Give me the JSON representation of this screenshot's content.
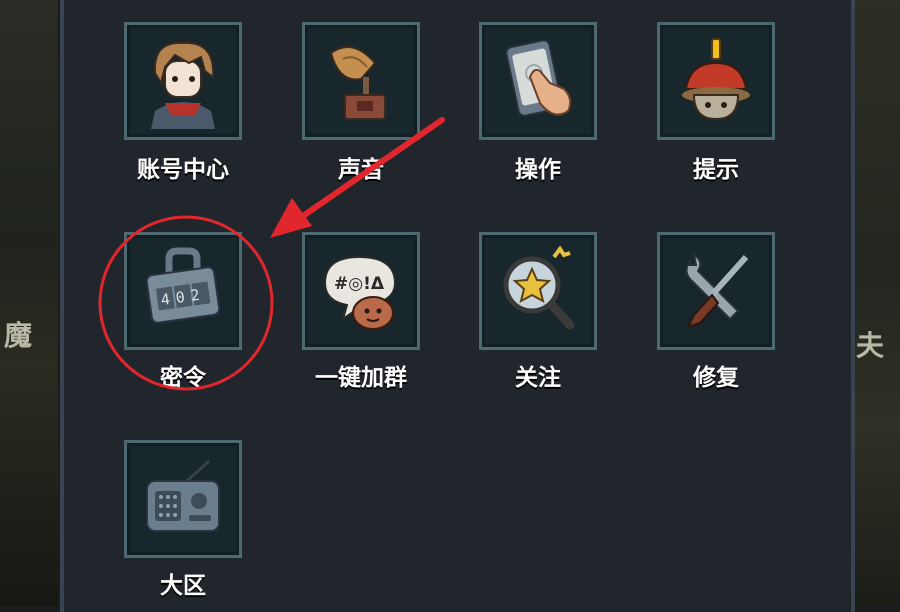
{
  "background": {
    "left_edge_text": "魔",
    "right_edge_text": "夫"
  },
  "menu": {
    "items": [
      {
        "label": "账号中心",
        "icon": "avatar-icon"
      },
      {
        "label": "声音",
        "icon": "gramophone-icon"
      },
      {
        "label": "操作",
        "icon": "touch-phone-icon"
      },
      {
        "label": "提示",
        "icon": "alert-mushroom-icon"
      },
      {
        "label": "密令",
        "icon": "combination-lock-icon"
      },
      {
        "label": "一键加群",
        "icon": "chat-bubble-icon"
      },
      {
        "label": "关注",
        "icon": "magnifier-star-icon"
      },
      {
        "label": "修复",
        "icon": "wrench-screwdriver-icon"
      },
      {
        "label": "大区",
        "icon": "radio-icon"
      }
    ]
  },
  "lock_code": "402",
  "bubble_text": "#◎!Δ",
  "colors": {
    "panel": "#20262c",
    "tile_bg": "#17272b",
    "tile_border": "#4e6a70",
    "annotation": "#e2262e"
  }
}
